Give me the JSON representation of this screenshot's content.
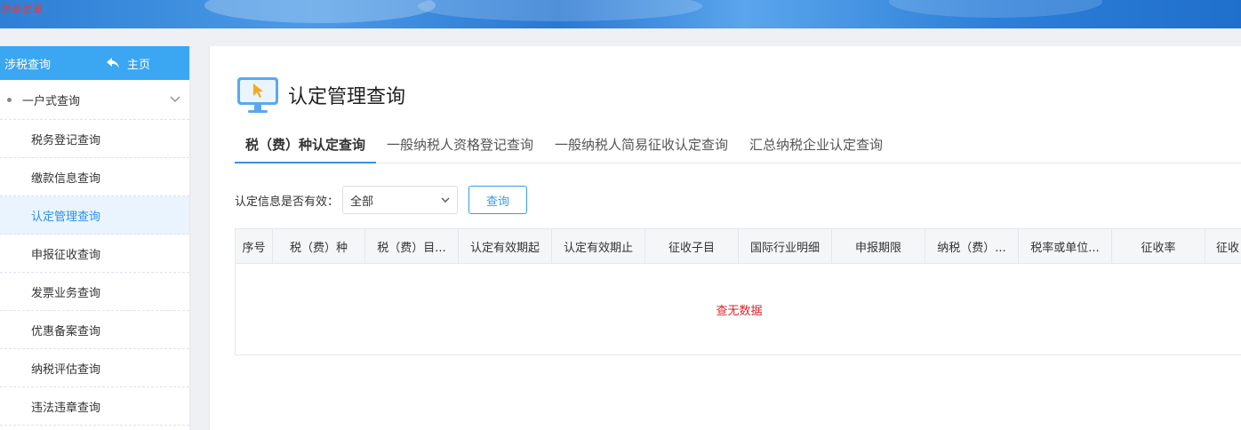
{
  "banner": {
    "logo_text": "税务总局",
    "colors": {
      "primary": "#2e7fd6"
    }
  },
  "sidebar": {
    "title": "涉税查询",
    "home_label": "主页",
    "group_label": "一户式查询",
    "items": [
      {
        "label": "税务登记查询",
        "active": false
      },
      {
        "label": "缴款信息查询",
        "active": false
      },
      {
        "label": "认定管理查询",
        "active": true
      },
      {
        "label": "申报征收查询",
        "active": false
      },
      {
        "label": "发票业务查询",
        "active": false
      },
      {
        "label": "优惠备案查询",
        "active": false
      },
      {
        "label": "纳税评估查询",
        "active": false
      },
      {
        "label": "违法违章查询",
        "active": false
      }
    ]
  },
  "main": {
    "title": "认定管理查询",
    "tabs": [
      {
        "label": "税（费）种认定查询",
        "active": true
      },
      {
        "label": "一般纳税人资格登记查询",
        "active": false
      },
      {
        "label": "一般纳税人简易征收认定查询",
        "active": false
      },
      {
        "label": "汇总纳税企业认定查询",
        "active": false
      }
    ],
    "filter": {
      "label": "认定信息是否有效：",
      "selected": "全部",
      "query_button": "查询"
    },
    "table": {
      "columns": [
        "序号",
        "税（费）种",
        "税（费）目...",
        "认定有效期起",
        "认定有效期止",
        "征收子目",
        "国际行业明细",
        "申报期限",
        "纳税（费）...",
        "税率或单位...",
        "征收率",
        "征收"
      ],
      "empty_text": "查无数据"
    }
  },
  "colors": {
    "accent": "#3ba6f2",
    "active_text": "#2f8fe4",
    "empty_text": "#d9252b"
  }
}
